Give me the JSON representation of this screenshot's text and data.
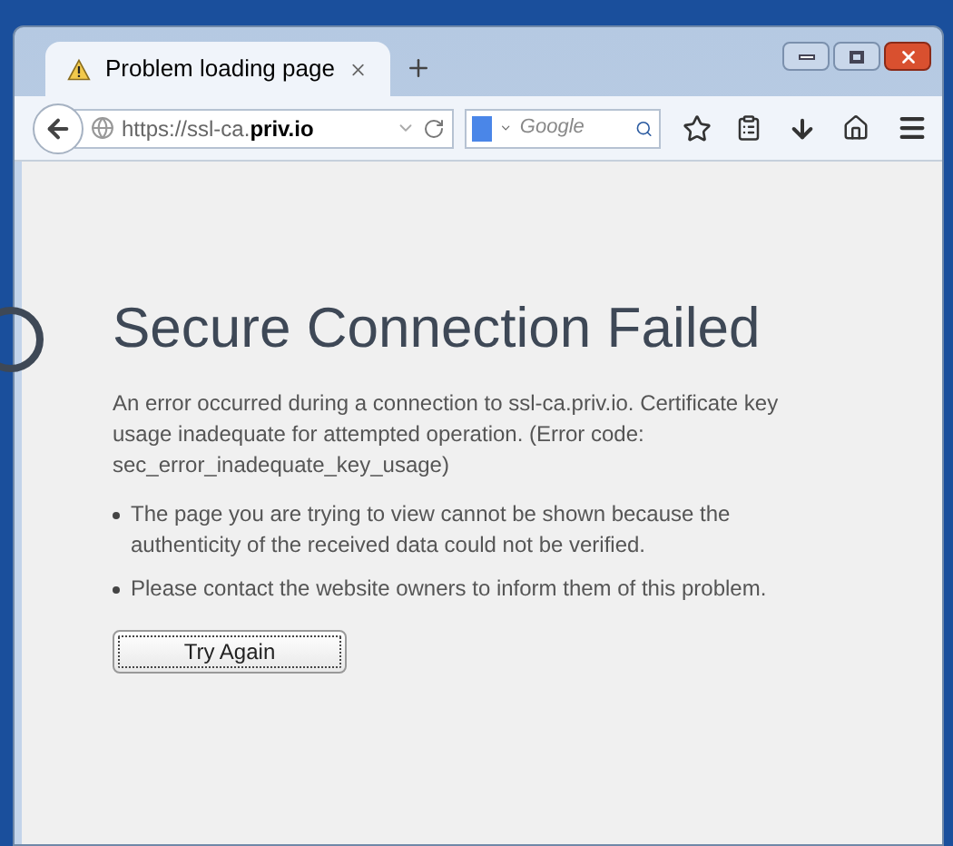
{
  "tab": {
    "title": "Problem loading page",
    "selected": true
  },
  "address": {
    "url": "https://ssl-ca.**priv.io**"
  },
  "search": {
    "placeholder": "Google"
  },
  "error": {
    "title": "Secure Connection Failed",
    "description": "An error occurred during a connection to ssl-ca.priv.io. Certificate key usage inadequate for attempted operation. (Error code: sec_error_inadequate_key_usage)",
    "bullets": [
      "The page you are trying to view cannot be shown because the authenticity of the received data could not be verified.",
      "Please contact the website owners to inform them of this problem."
    ],
    "button": "Try Again"
  }
}
